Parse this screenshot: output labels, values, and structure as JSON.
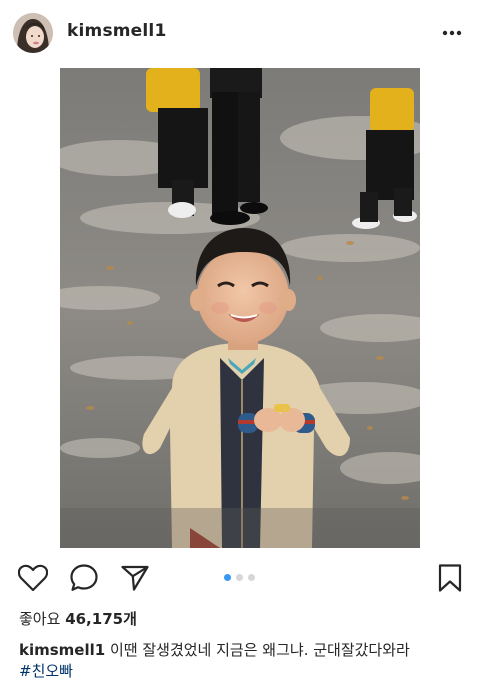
{
  "post": {
    "username": "kimsmell1",
    "more_icon": "more-horizontal-icon"
  },
  "actions": {
    "icons": [
      "heart-icon",
      "comment-icon",
      "share-icon",
      "bookmark-icon"
    ],
    "carousel_total": 3,
    "carousel_active_index": 0,
    "accent_color": "#3897f0"
  },
  "likes": {
    "label": "좋아요",
    "count": "46,175개"
  },
  "caption": {
    "username": "kimsmell1",
    "text": "이땐 잘생겼었네  지금은 왜그냐.  군대잘갔다와라",
    "hashtag": "#친오빠",
    "hashtag_color": "#003569"
  }
}
